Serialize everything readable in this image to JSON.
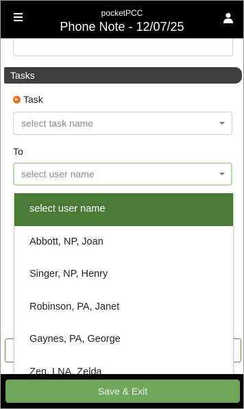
{
  "header": {
    "app_name": "pocketPCC",
    "title": "Phone Note - 12/07/25",
    "menu_icon": "hamburger-menu-icon",
    "user_icon": "user-icon"
  },
  "tasks_section": {
    "title": "Tasks",
    "task_label": "Task",
    "task_placeholder": "select task name",
    "to_label": "To",
    "to_placeholder": "select user name"
  },
  "dropdown": {
    "options": [
      {
        "label": "select user name",
        "selected": true
      },
      {
        "label": "Abbott, NP, Joan",
        "selected": false
      },
      {
        "label": "Singer, NP, Henry",
        "selected": false
      },
      {
        "label": "Robinson, PA, Janet",
        "selected": false
      },
      {
        "label": "Gaynes, PA, George",
        "selected": false
      },
      {
        "label": "Zen, LNA, Zelda",
        "selected": false
      }
    ]
  },
  "footer": {
    "save_exit_label": "Save & Exit"
  },
  "colors": {
    "header_bg": "#000000",
    "section_bar_bg": "#3f3f3f",
    "selected_option_bg": "#4a7a36",
    "save_button_bg": "#70a65a",
    "required_icon": "#f26b21"
  }
}
